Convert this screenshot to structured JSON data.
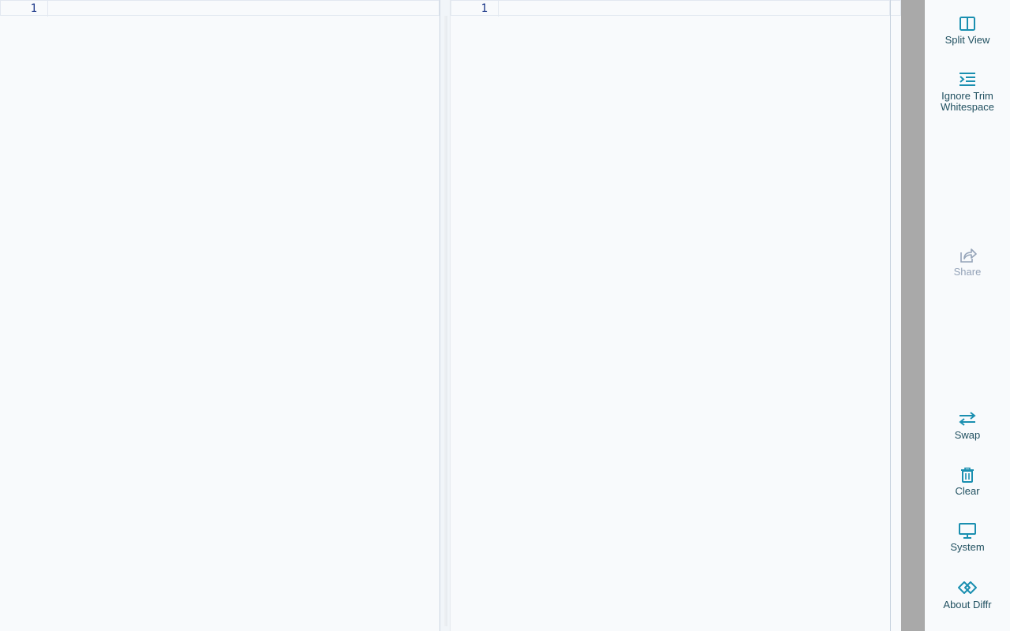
{
  "editor": {
    "left": {
      "line_numbers": [
        "1"
      ]
    },
    "right": {
      "line_numbers": [
        "1"
      ]
    }
  },
  "toolbar": {
    "split_view": {
      "label": "Split View",
      "icon": "split-view-icon"
    },
    "ignore_trim": {
      "label": "Ignore Trim Whitespace",
      "icon": "indent-icon"
    },
    "share": {
      "label": "Share",
      "icon": "share-icon",
      "disabled": true
    },
    "swap": {
      "label": "Swap",
      "icon": "swap-arrows-icon"
    },
    "clear": {
      "label": "Clear",
      "icon": "trash-icon"
    },
    "system": {
      "label": "System",
      "icon": "monitor-icon"
    },
    "about": {
      "label": "About Diffr",
      "icon": "diffr-logo-icon"
    }
  },
  "colors": {
    "accent": "#1a8fb0",
    "label": "#1f4f5f",
    "disabled": "#94a3b8",
    "line_number": "#1e3a8a",
    "scrollbar": "#a9a9a9"
  }
}
